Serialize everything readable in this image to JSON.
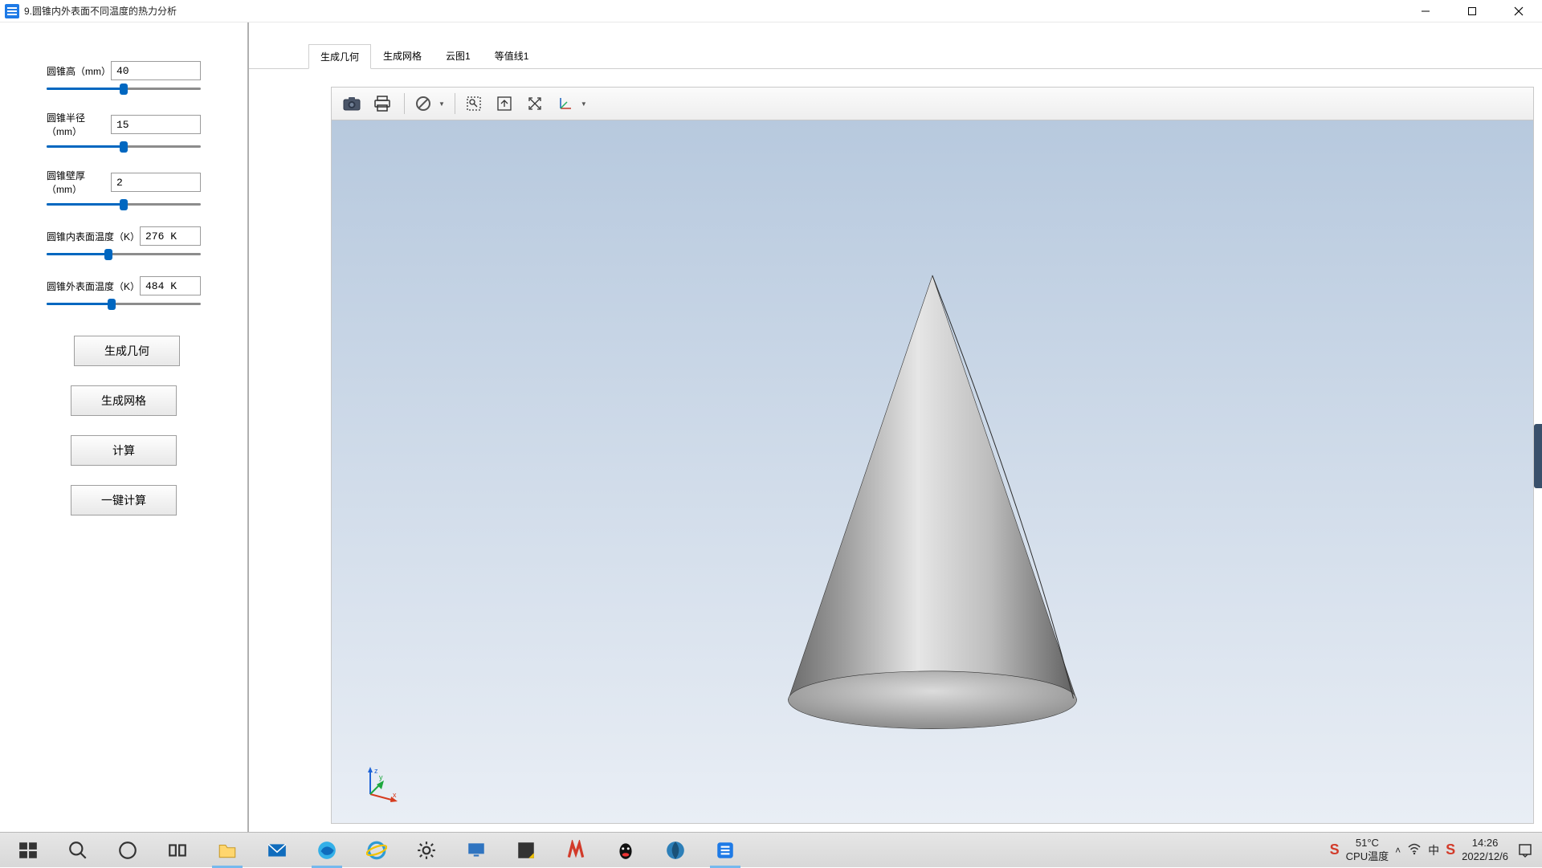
{
  "window": {
    "title": "9.圆锥内外表面不同温度的热力分析"
  },
  "params": {
    "height": {
      "label": "圆锥高（mm）",
      "value": "40",
      "fill_pct": 50
    },
    "radius": {
      "label": "圆锥半径（mm）",
      "value": "15",
      "fill_pct": 50
    },
    "thickness": {
      "label": "圆锥壁厚（mm）",
      "value": "2",
      "fill_pct": 50
    },
    "temp_in": {
      "label": "圆锥内表面温度（K）",
      "value": "276 K",
      "fill_pct": 40
    },
    "temp_out": {
      "label": "圆锥外表面温度（K）",
      "value": "484 K",
      "fill_pct": 42
    }
  },
  "buttons": {
    "gen_geom": "生成几何",
    "gen_mesh": "生成网格",
    "compute": "计算",
    "one_click": "一键计算"
  },
  "tabs": {
    "t1": "生成几何",
    "t2": "生成网格",
    "t3": "云图1",
    "t4": "等值线1"
  },
  "systray": {
    "temp_value": "51°C",
    "temp_label": "CPU温度",
    "time": "14:26",
    "date": "2022/12/6"
  }
}
